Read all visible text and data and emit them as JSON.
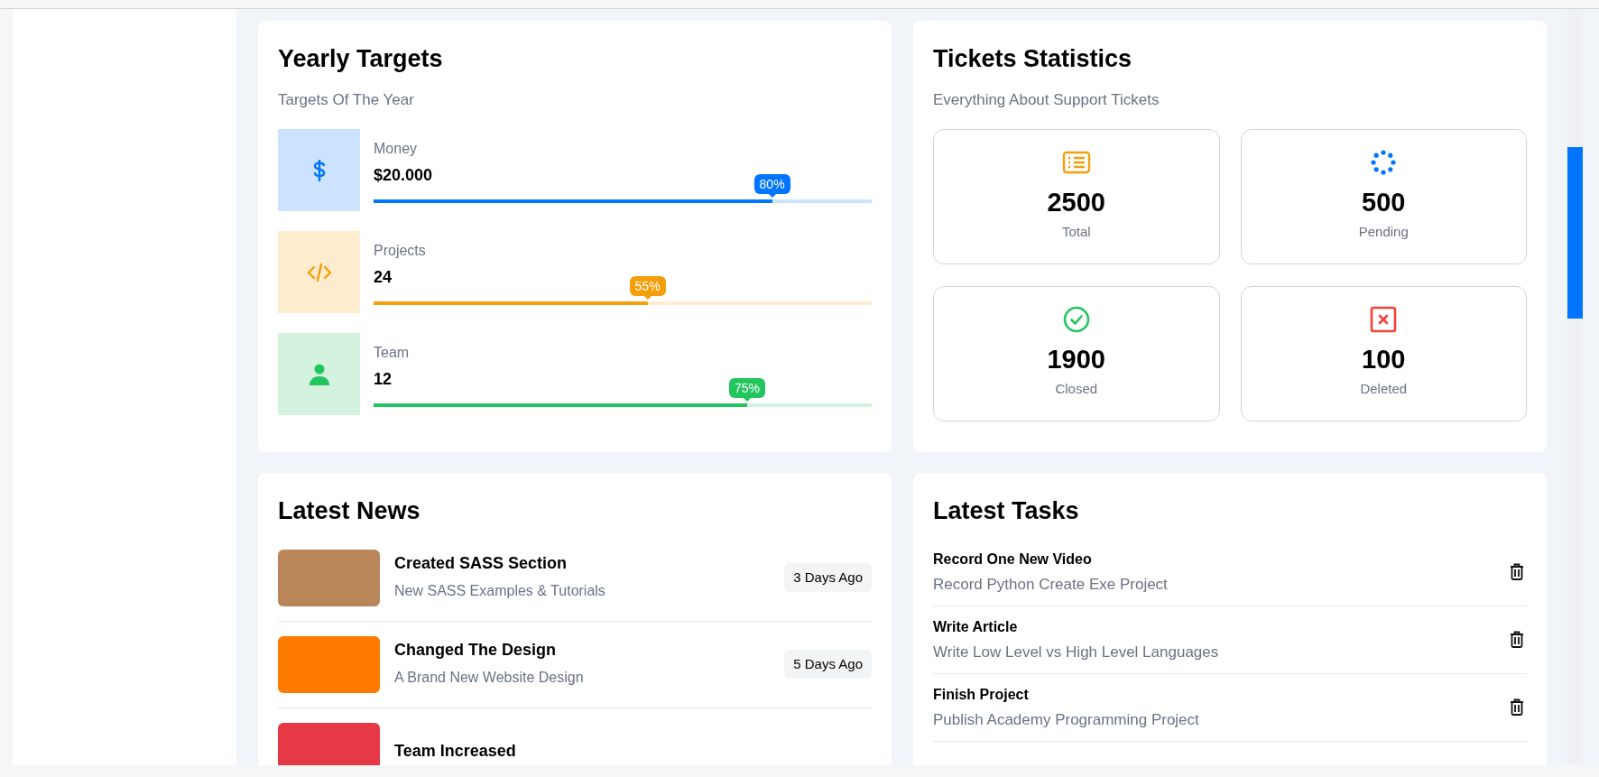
{
  "targets": {
    "title": "Yearly Targets",
    "subtitle": "Targets Of The Year",
    "items": [
      {
        "label": "Money",
        "value": "$20.000",
        "percent": "80%",
        "level": 0.8,
        "color": "#0075ff"
      },
      {
        "label": "Projects",
        "value": "24",
        "percent": "55%",
        "level": 0.55,
        "color": "#f59e0b"
      },
      {
        "label": "Team",
        "value": "12",
        "percent": "75%",
        "level": 0.75,
        "color": "#22c55e"
      }
    ]
  },
  "tickets": {
    "title": "Tickets Statistics",
    "subtitle": "Everything About Support Tickets",
    "stats": [
      {
        "number": "2500",
        "label": "Total",
        "color": "#f59e0b"
      },
      {
        "number": "500",
        "label": "Pending",
        "color": "#0075ff"
      },
      {
        "number": "1900",
        "label": "Closed",
        "color": "#22c55e"
      },
      {
        "number": "100",
        "label": "Deleted",
        "color": "#f44336"
      }
    ]
  },
  "news": {
    "title": "Latest News",
    "items": [
      {
        "title": "Created SASS Section",
        "description": "New SASS Examples & Tutorials",
        "time": "3 Days Ago"
      },
      {
        "title": "Changed The Design",
        "description": "A Brand New Website Design",
        "time": "5 Days Ago"
      },
      {
        "title": "Team Increased"
      }
    ]
  },
  "tasks": {
    "title": "Latest Tasks",
    "items": [
      {
        "title": "Record One New Video",
        "description": "Record Python Create Exe Project"
      },
      {
        "title": "Write Article",
        "description": "Write Low Level vs High Level Languages"
      },
      {
        "title": "Finish Project",
        "description": "Publish Academy Programming Project"
      }
    ]
  }
}
